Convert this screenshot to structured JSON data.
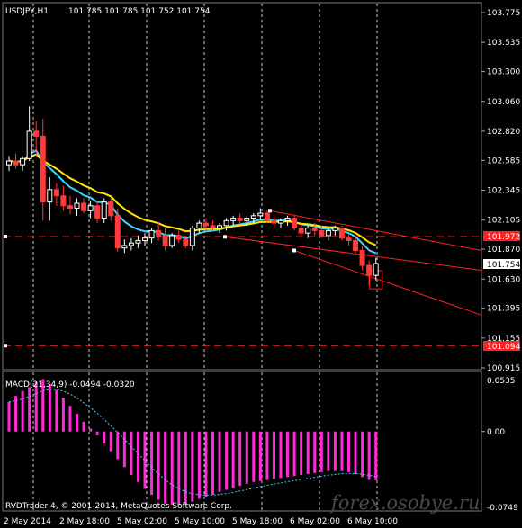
{
  "header": {
    "symbol": "USDJPY,H1",
    "ohlc": "101.785 101.785 101.752 101.754"
  },
  "macd": {
    "label": "MACD(21,34,9) -0.0494 -0.0320",
    "top_label": "0.0535",
    "zero_label": "0.00",
    "bottom_label": "-0.0749"
  },
  "footer": {
    "copyright": "RVDTrader 4, © 2001-2014, MetaQuotes Software Corp.",
    "watermark": "forex.osobye.ru"
  },
  "markers": {
    "bid_line": "101.972",
    "low_line": "101.094",
    "current_price": "101.754"
  },
  "chart_data": {
    "type": "candlestick",
    "symbol": "USDJPY",
    "timeframe": "H1",
    "price_axis": [
      "103.775",
      "103.535",
      "103.300",
      "103.060",
      "102.820",
      "102.585",
      "102.345",
      "102.105",
      "101.870",
      "101.630",
      "101.395",
      "101.155",
      "100.915"
    ],
    "ylim": [
      100.915,
      103.775
    ],
    "time_axis": [
      "2 May 2014",
      "2 May 18:00",
      "5 May 02:00",
      "5 May 10:00",
      "5 May 18:00",
      "6 May 02:00",
      "6 May 10:00"
    ],
    "candles": [
      {
        "o": 102.55,
        "h": 102.62,
        "l": 102.5,
        "c": 102.58
      },
      {
        "o": 102.58,
        "h": 102.64,
        "l": 102.52,
        "c": 102.55
      },
      {
        "o": 102.55,
        "h": 102.62,
        "l": 102.5,
        "c": 102.6
      },
      {
        "o": 102.6,
        "h": 103.02,
        "l": 102.58,
        "c": 102.82
      },
      {
        "o": 102.82,
        "h": 102.9,
        "l": 102.62,
        "c": 102.78
      },
      {
        "o": 102.78,
        "h": 102.92,
        "l": 102.1,
        "c": 102.25
      },
      {
        "o": 102.25,
        "h": 102.45,
        "l": 102.1,
        "c": 102.35
      },
      {
        "o": 102.35,
        "h": 102.4,
        "l": 102.22,
        "c": 102.3
      },
      {
        "o": 102.3,
        "h": 102.38,
        "l": 102.18,
        "c": 102.22
      },
      {
        "o": 102.22,
        "h": 102.3,
        "l": 102.15,
        "c": 102.2
      },
      {
        "o": 102.2,
        "h": 102.28,
        "l": 102.14,
        "c": 102.24
      },
      {
        "o": 102.24,
        "h": 102.28,
        "l": 102.16,
        "c": 102.18
      },
      {
        "o": 102.18,
        "h": 102.26,
        "l": 102.12,
        "c": 102.22
      },
      {
        "o": 102.22,
        "h": 102.26,
        "l": 102.08,
        "c": 102.12
      },
      {
        "o": 102.12,
        "h": 102.28,
        "l": 102.08,
        "c": 102.25
      },
      {
        "o": 102.25,
        "h": 102.28,
        "l": 102.1,
        "c": 102.14
      },
      {
        "o": 102.14,
        "h": 102.2,
        "l": 101.85,
        "c": 101.88
      },
      {
        "o": 101.88,
        "h": 101.95,
        "l": 101.84,
        "c": 101.9
      },
      {
        "o": 101.9,
        "h": 101.96,
        "l": 101.86,
        "c": 101.92
      },
      {
        "o": 101.92,
        "h": 101.98,
        "l": 101.88,
        "c": 101.94
      },
      {
        "o": 101.94,
        "h": 102.0,
        "l": 101.9,
        "c": 101.96
      },
      {
        "o": 101.96,
        "h": 102.04,
        "l": 101.92,
        "c": 102.02
      },
      {
        "o": 102.02,
        "h": 102.08,
        "l": 101.94,
        "c": 101.98
      },
      {
        "o": 101.98,
        "h": 102.04,
        "l": 101.86,
        "c": 101.9
      },
      {
        "o": 101.9,
        "h": 102.0,
        "l": 101.88,
        "c": 101.98
      },
      {
        "o": 101.98,
        "h": 102.02,
        "l": 101.92,
        "c": 101.95
      },
      {
        "o": 101.95,
        "h": 101.98,
        "l": 101.88,
        "c": 101.9
      },
      {
        "o": 101.9,
        "h": 102.06,
        "l": 101.86,
        "c": 102.04
      },
      {
        "o": 102.04,
        "h": 102.1,
        "l": 102.0,
        "c": 102.08
      },
      {
        "o": 102.08,
        "h": 102.12,
        "l": 102.02,
        "c": 102.06
      },
      {
        "o": 102.06,
        "h": 102.1,
        "l": 102.02,
        "c": 102.04
      },
      {
        "o": 102.04,
        "h": 102.08,
        "l": 102.0,
        "c": 102.06
      },
      {
        "o": 102.06,
        "h": 102.12,
        "l": 102.02,
        "c": 102.1
      },
      {
        "o": 102.1,
        "h": 102.14,
        "l": 102.06,
        "c": 102.12
      },
      {
        "o": 102.12,
        "h": 102.16,
        "l": 102.08,
        "c": 102.1
      },
      {
        "o": 102.1,
        "h": 102.14,
        "l": 102.06,
        "c": 102.12
      },
      {
        "o": 102.12,
        "h": 102.16,
        "l": 102.08,
        "c": 102.14
      },
      {
        "o": 102.14,
        "h": 102.2,
        "l": 102.1,
        "c": 102.16
      },
      {
        "o": 102.16,
        "h": 102.18,
        "l": 102.08,
        "c": 102.1
      },
      {
        "o": 102.1,
        "h": 102.14,
        "l": 102.04,
        "c": 102.08
      },
      {
        "o": 102.08,
        "h": 102.12,
        "l": 102.04,
        "c": 102.1
      },
      {
        "o": 102.1,
        "h": 102.14,
        "l": 102.06,
        "c": 102.12
      },
      {
        "o": 102.12,
        "h": 102.14,
        "l": 102.02,
        "c": 102.04
      },
      {
        "o": 102.04,
        "h": 102.08,
        "l": 101.98,
        "c": 102.0
      },
      {
        "o": 102.0,
        "h": 102.06,
        "l": 101.96,
        "c": 102.04
      },
      {
        "o": 102.04,
        "h": 102.08,
        "l": 101.98,
        "c": 102.02
      },
      {
        "o": 102.02,
        "h": 102.06,
        "l": 101.96,
        "c": 101.98
      },
      {
        "o": 101.98,
        "h": 102.04,
        "l": 101.94,
        "c": 102.02
      },
      {
        "o": 102.02,
        "h": 102.06,
        "l": 101.98,
        "c": 102.04
      },
      {
        "o": 102.04,
        "h": 102.06,
        "l": 101.94,
        "c": 101.96
      },
      {
        "o": 101.96,
        "h": 102.0,
        "l": 101.9,
        "c": 101.94
      },
      {
        "o": 101.94,
        "h": 101.98,
        "l": 101.84,
        "c": 101.86
      },
      {
        "o": 101.86,
        "h": 101.9,
        "l": 101.7,
        "c": 101.74
      },
      {
        "o": 101.74,
        "h": 101.78,
        "l": 101.58,
        "c": 101.66
      },
      {
        "o": 101.66,
        "h": 101.8,
        "l": 101.62,
        "c": 101.754
      }
    ],
    "macd_hist": [
      0.03,
      0.036,
      0.041,
      0.045,
      0.05,
      0.053,
      0.048,
      0.042,
      0.034,
      0.026,
      0.018,
      0.01,
      0.003,
      -0.004,
      -0.012,
      -0.02,
      -0.028,
      -0.036,
      -0.044,
      -0.051,
      -0.058,
      -0.064,
      -0.069,
      -0.073,
      -0.074,
      -0.074,
      -0.073,
      -0.071,
      -0.068,
      -0.066,
      -0.064,
      -0.061,
      -0.059,
      -0.057,
      -0.055,
      -0.053,
      -0.051,
      -0.05,
      -0.049,
      -0.048,
      -0.047,
      -0.046,
      -0.045,
      -0.044,
      -0.043,
      -0.042,
      -0.041,
      -0.04,
      -0.04,
      -0.04,
      -0.041,
      -0.043,
      -0.046,
      -0.049,
      -0.0494
    ],
    "colors": {
      "bull": "#ffffff",
      "bear": "#ff3b3b",
      "ema_fast": "#3ad6ff",
      "ema_slow": "#ffe600",
      "channel": "#ff2020",
      "hline": "#ff2020",
      "hist": "#ff2bd6",
      "signal": "#3ad6ff",
      "grid": "#ffffff"
    }
  }
}
